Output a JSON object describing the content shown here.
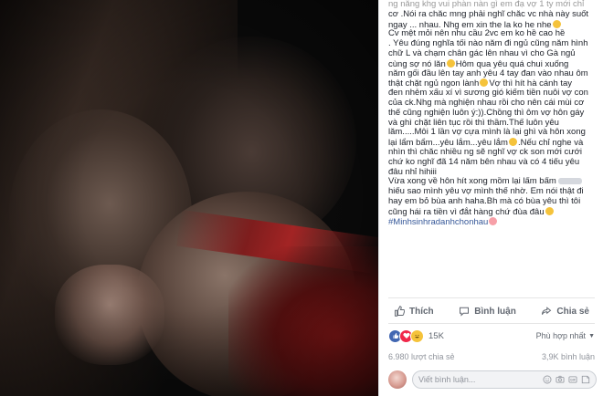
{
  "post": {
    "lines": [
      "ngay ... nhau. Nhg em xin the la ko he nhe",
      "Cv mệt mỏi nên nhu cầu 2vc em ko hề cao hề",
      ". Yêu đúng nghĩa tối nào nằm đi ngủ cũng nằm hình",
      "chữ L và chạm chân gác lên nhau vì cho Gà ngủ",
      "cùng sợ nó lăn",
      "Hôm qua yêu quá chui xuống",
      "nằm gối đầu lên tay anh yêu 4 tay đan vào nhau ôm",
      "thật chặt ngủ ngon lành",
      "Vợ thì hít hà cánh tay",
      "đen nhẻm xấu xí vì sương gió kiếm tiền nuôi vợ con",
      "của ck.Nhg mà nghiện nhau rồi cho nên cái mùi cơ",
      "thể cũng nghiện luôn ý:)).Chồng thì ôm vợ hôn gáy",
      "và ghì chặt liên tục rồi thì thầm.Thế luôn yêu",
      "lắm.....Mỗi 1 lần vợ cựa mình là lại ghì và hôn xong",
      "lại lẩm bẩm...yêu lắm...yêu lắm",
      ".Nếu chỉ nghe và",
      "nhìn thì chắc nhiều ng sẽ nghĩ vợ ck son mới cưới",
      "chứ ko nghĩ đã 14 năm bên nhau và có 4 tiểu yêu",
      "đâu nhỉ hihiii",
      "Vừa xong về hôn hít xong mồm lại lẩm bẩm",
      "hiểu sao mình yêu vợ mình thế nhờ. Em nói thật đi",
      "hay em bỏ bùa anh haha.Bh mà có bùa yêu thì tôi",
      "cũng hái ra tiền vì đắt hàng chứ đùa đâu",
      "#Minhsinhradanhchonhau"
    ],
    "top_partial": "ng năng khg vui phàn nàn gì em đạ vợ 1 ty mới chỉ",
    "top_partial2": "cơ .Nói ra chắc mng phải nghĩ chắc vc nhà này suốt"
  },
  "actions": {
    "like": "Thích",
    "comment": "Bình luận",
    "share": "Chia sẻ"
  },
  "reactions": {
    "count": "15K",
    "sort_label": "Phù hợp nhất"
  },
  "stats": {
    "shares": "6.980 lượt chia sẻ",
    "comments": "3,9K bình luận"
  },
  "comment_box": {
    "placeholder": "Viết bình luận..."
  },
  "colors": {
    "link": "#365899",
    "muted": "#616770",
    "like_blue": "#4267b2",
    "love_red": "#f0284a",
    "haha_yellow": "#f5c33b"
  },
  "icons": {
    "like": "thumbs-up-icon",
    "comment": "speech-bubble-icon",
    "share": "share-arrow-icon",
    "camera": "camera-icon",
    "emoji": "smiley-icon",
    "gif": "gif-icon",
    "sticker": "sticker-icon"
  }
}
